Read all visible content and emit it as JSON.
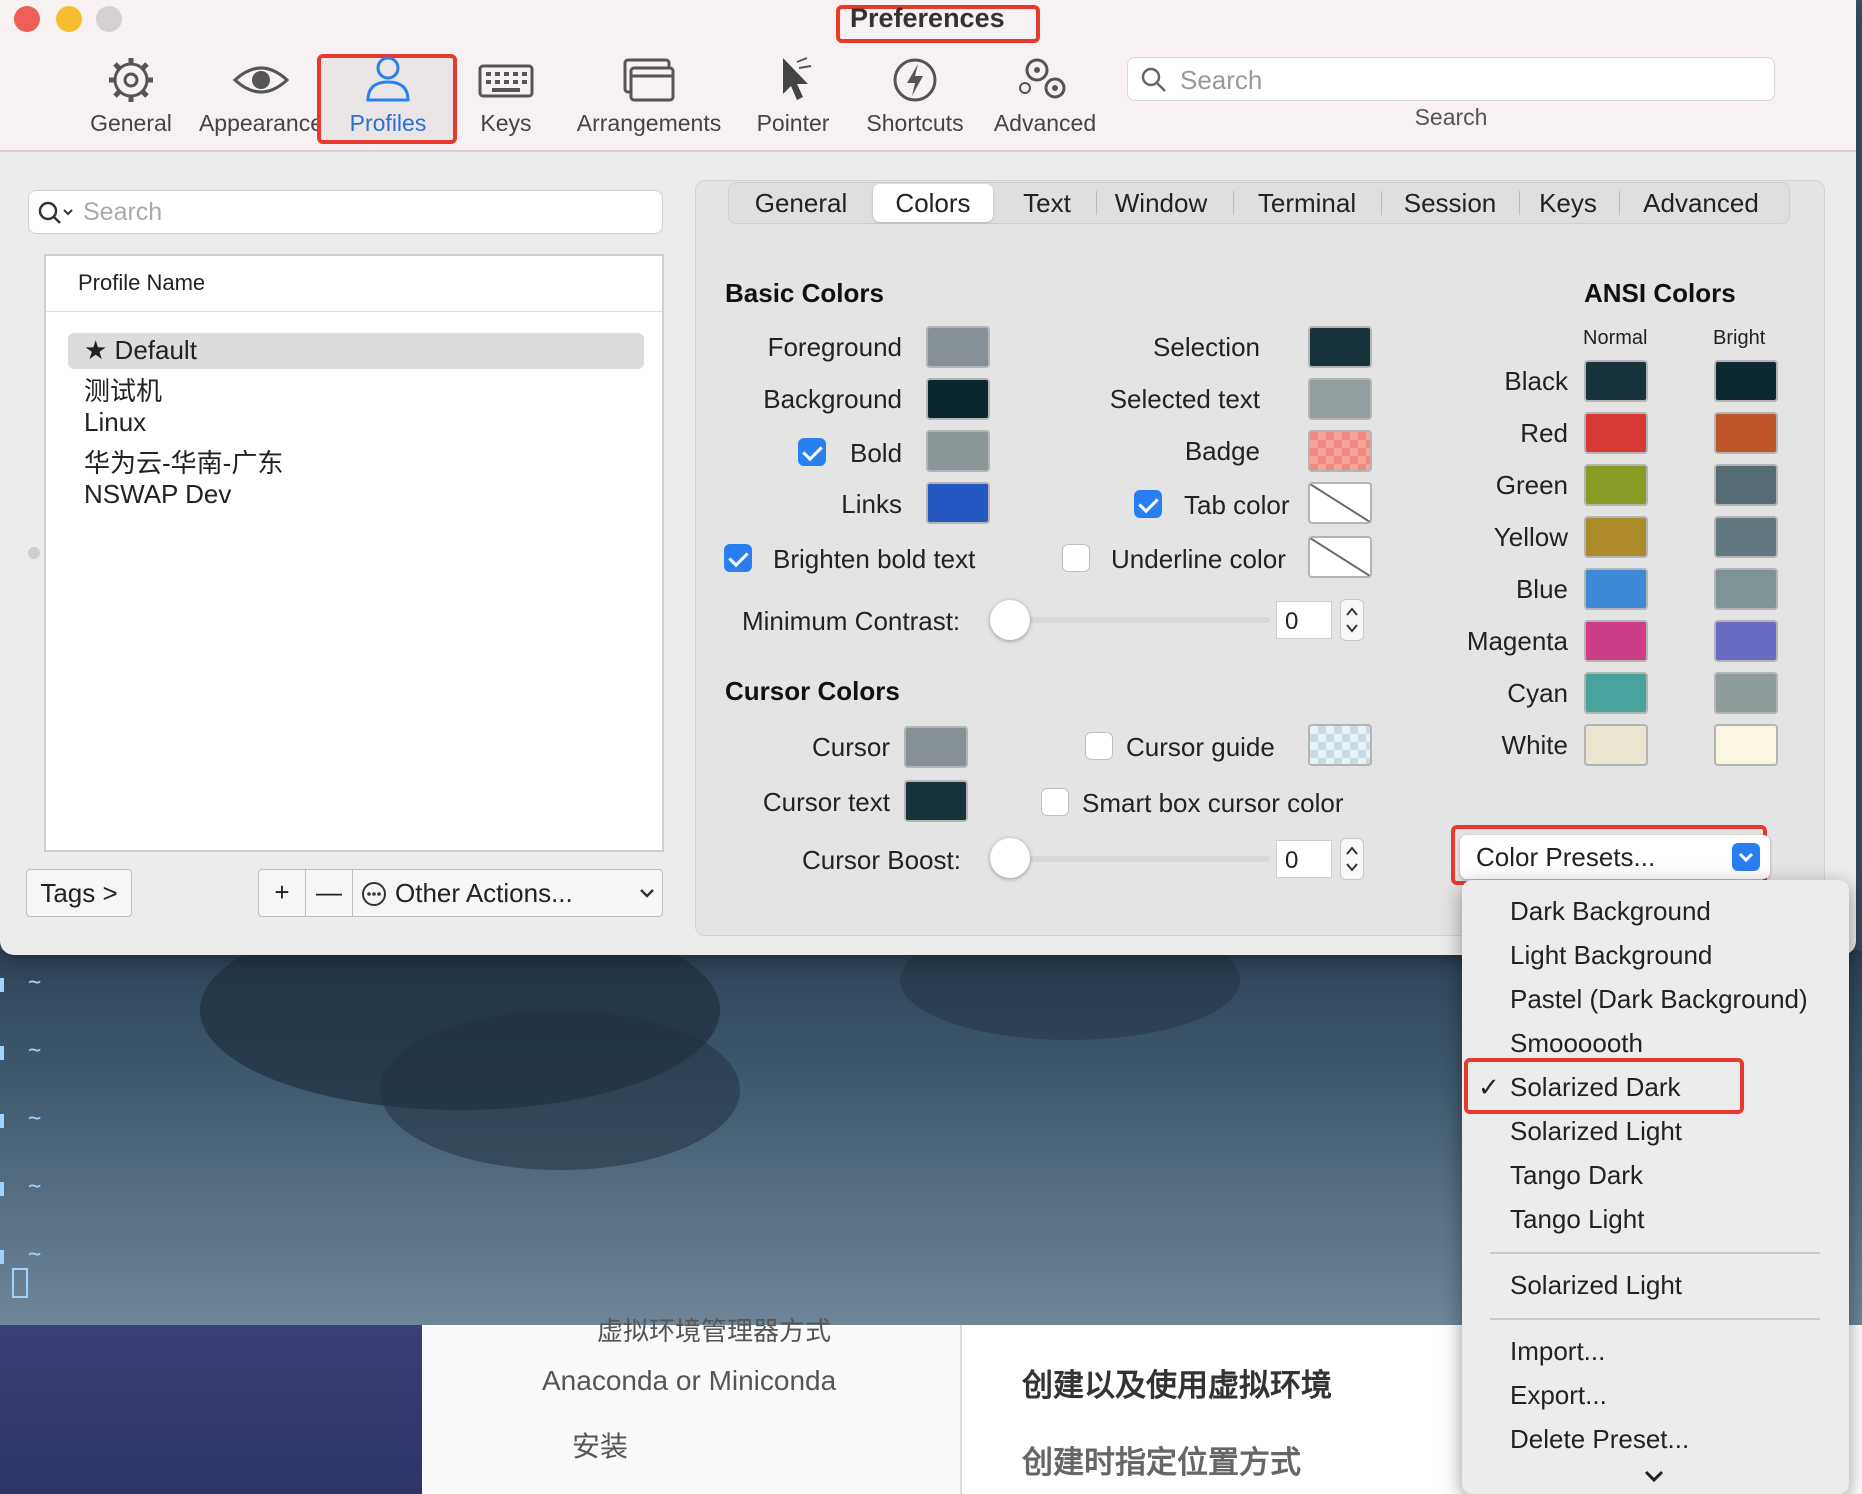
{
  "window": {
    "title": "Preferences"
  },
  "toolbar": {
    "items": [
      {
        "label": "General",
        "icon": "gear-icon"
      },
      {
        "label": "Appearance",
        "icon": "eye-icon"
      },
      {
        "label": "Profiles",
        "icon": "person-icon"
      },
      {
        "label": "Keys",
        "icon": "keyboard-icon"
      },
      {
        "label": "Arrangements",
        "icon": "windows-icon"
      },
      {
        "label": "Pointer",
        "icon": "pointer-icon"
      },
      {
        "label": "Shortcuts",
        "icon": "bolt-icon"
      },
      {
        "label": "Advanced",
        "icon": "gears-icon"
      }
    ],
    "search_placeholder": "Search",
    "search_label": "Search"
  },
  "profiles": {
    "search_placeholder": "Search",
    "column_header": "Profile Name",
    "items": [
      "Default",
      "测试机",
      "Linux",
      "华为云-华南-广东",
      "NSWAP Dev"
    ],
    "tags_button": "Tags >",
    "add_label": "+",
    "remove_label": "—",
    "other_actions": "Other Actions..."
  },
  "tabs": [
    "General",
    "Colors",
    "Text",
    "Window",
    "Terminal",
    "Session",
    "Keys",
    "Advanced"
  ],
  "basic_colors": {
    "title": "Basic Colors",
    "foreground": "Foreground",
    "background": "Background",
    "bold": "Bold",
    "links": "Links",
    "selection": "Selection",
    "selected_text": "Selected text",
    "badge": "Badge",
    "tab_color": "Tab color",
    "brighten_bold": "Brighten bold text",
    "underline_color": "Underline color",
    "min_contrast": "Minimum Contrast:",
    "min_contrast_value": "0"
  },
  "cursor_colors": {
    "title": "Cursor Colors",
    "cursor": "Cursor",
    "cursor_text": "Cursor text",
    "cursor_guide": "Cursor guide",
    "smart_box": "Smart box cursor color",
    "cursor_boost": "Cursor Boost:",
    "cursor_boost_value": "0"
  },
  "colors": {
    "foreground": "#859196",
    "background": "#0c2630",
    "bold": "#8a9698",
    "links": "#2558c0",
    "selection": "#17323b",
    "selected_text": "#939ea0",
    "badge": "#f08a80",
    "cursor": "#859196",
    "cursor_text": "#17323b",
    "accent": "#2a7ff0",
    "highlight": "#e8392e"
  },
  "ansi": {
    "title": "ANSI Colors",
    "normal_label": "Normal",
    "bright_label": "Bright",
    "rows": [
      {
        "name": "Black",
        "normal": "#17323b",
        "bright": "#0d2831"
      },
      {
        "name": "Red",
        "normal": "#d63a32",
        "bright": "#c2542a"
      },
      {
        "name": "Green",
        "normal": "#879c25",
        "bright": "#566b73"
      },
      {
        "name": "Yellow",
        "normal": "#ad8b2a",
        "bright": "#637880"
      },
      {
        "name": "Blue",
        "normal": "#3d89d6",
        "bright": "#7f9296"
      },
      {
        "name": "Magenta",
        "normal": "#cc3f87",
        "bright": "#6a6cc4"
      },
      {
        "name": "Cyan",
        "normal": "#47a39c",
        "bright": "#8f9c9c"
      },
      {
        "name": "White",
        "normal": "#ebe6d2",
        "bright": "#fbf6e4"
      }
    ]
  },
  "presets": {
    "button_label": "Color Presets...",
    "menu": [
      "Dark Background",
      "Light Background",
      "Pastel (Dark Background)",
      "Smoooooth",
      "Solarized Dark",
      "Solarized Light",
      "Tango Dark",
      "Tango Light"
    ],
    "custom": [
      "Solarized Light"
    ],
    "actions": [
      "Import...",
      "Export...",
      "Delete Preset..."
    ],
    "checked": "Solarized Dark"
  },
  "background_page": {
    "line1": "虚拟环境管理器方式",
    "line2": "Anaconda or Miniconda",
    "line3": "安装",
    "heading1": "创建以及使用虚拟环境",
    "heading2": "创建时指定位置方式"
  }
}
